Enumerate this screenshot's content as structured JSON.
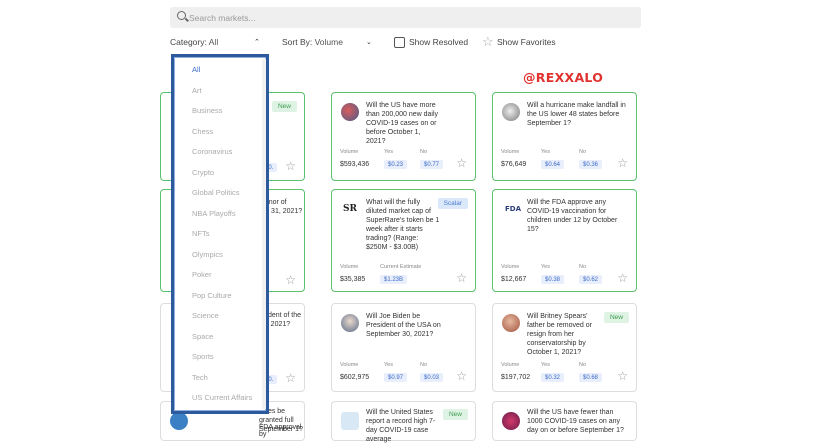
{
  "search": {
    "placeholder": "Search markets..."
  },
  "filters": {
    "category_label": "Category:",
    "category_value": "All",
    "sort_label": "Sort By:",
    "sort_value": "Volume",
    "show_resolved": "Show Resolved",
    "show_favorites": "Show Favorites"
  },
  "watermark": "@REXXALO",
  "labels": {
    "volume": "Volume",
    "yes": "Yes",
    "no": "No",
    "current_estimate": "Current Estimate"
  },
  "dropdown": {
    "options": [
      "All",
      "Art",
      "Business",
      "Chess",
      "Coronavirus",
      "Crypto",
      "Global Politics",
      "NBA Playoffs",
      "NFTs",
      "Olympics",
      "Poker",
      "Pop Culture",
      "Science",
      "Space",
      "Sports",
      "Tech",
      "US Current Affairs"
    ],
    "selected": "All"
  },
  "cards": [
    {
      "question": "Will the US have more than 200,000 new daily COVID-19 cases on or before October 1, 2021?",
      "volume": "$593,436",
      "yes": "$0.23",
      "no": "$0.77"
    },
    {
      "question": "Will a hurricane make landfall in the US lower 48 states before September 1?",
      "volume": "$76,649",
      "yes": "$0.64",
      "no": "$0.36"
    },
    {
      "question": "What will the fully diluted market cap of SuperRare's token be 1 week after it starts trading? (Range: $250M - $3.00B)",
      "badge": "Scalar",
      "thumb_text": "SR",
      "volume": "$35,385",
      "estimate": "$1.23B"
    },
    {
      "question": "Will the FDA approve any COVID-19 vaccination for children under 12 by October 15?",
      "thumb_text": "FDA",
      "volume": "$12,667",
      "yes": "$0.38",
      "no": "$0.62"
    },
    {
      "question": "Will Joe Biden be President of the USA on September 30, 2021?",
      "volume": "$602,975",
      "yes": "$0.97",
      "no": "$0.03"
    },
    {
      "question": "Will Britney Spears' father be removed or resign from her conservatorship by October 1, 2021?",
      "badge": "New",
      "volume": "$197,702",
      "yes": "$0.32",
      "no": "$0.68"
    },
    {
      "question": "Will the United States report a record high 7-day COVID-19 case average",
      "badge": "New"
    },
    {
      "question": "Will the US have fewer than 1000 COVID-19 cases on any day on or before September 1?"
    }
  ],
  "peek": {
    "c1_badge": "New",
    "c1_a": "rt",
    "c1_b": "1s",
    "c1_vol": "$6",
    "c1_val": "$0.",
    "c2_a": "vernor of",
    "c2_b": "ber 31, 2021?",
    "c2_vol": "$3",
    "c3_a": "esident of the",
    "c3_b": "30, 2021?",
    "c3_vol": "$5",
    "c3_val": "$0.",
    "c4_a": "cines be",
    "c4_b": "granted full FDA approval by",
    "c4_c": "September 1?"
  },
  "colors": {
    "accent": "#3f6fcf",
    "green_border": "#5ac26d",
    "dropdown_border": "#2d5a9c",
    "watermark": "#e0322f"
  }
}
